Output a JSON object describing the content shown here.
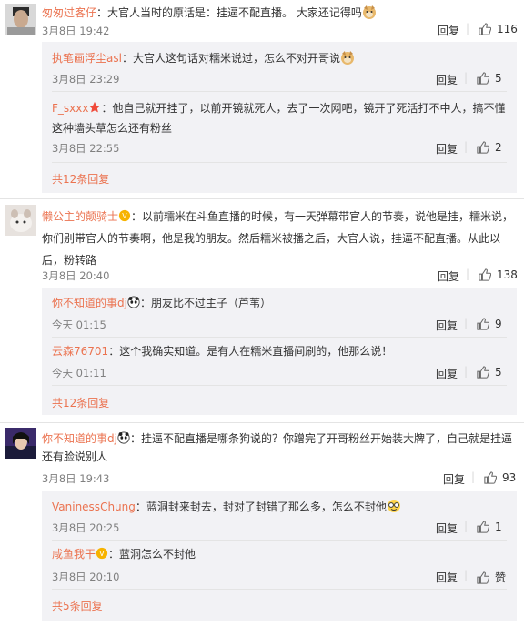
{
  "comments": [
    {
      "user": "匆匆过客仔",
      "text": "：大官人当时的原话是：挂逼不配直播。 大家还记得吗",
      "time": "3月8日 19:42",
      "reply_label": "回复",
      "likes": "116",
      "replies": [
        {
          "user": "执笔画浮尘asl",
          "text": "：大官人这句话对糯米说过，怎么不对开哥说",
          "time": "3月8日 23:29",
          "reply_label": "回复",
          "likes": "5"
        },
        {
          "user": "F_sxxx",
          "text": "：他自己就开挂了，以前开镜就死人，去了一次网吧，镜开了死活打不中人，搞不懂这种墙头草怎么还有粉丝",
          "time": "3月8日 22:55",
          "reply_label": "回复",
          "likes": "2"
        }
      ],
      "more": "共12条回复"
    },
    {
      "user": "懒公主的颠骑士",
      "text": "：以前糯米在斗鱼直播的时候，有一天弹幕带官人的节奏，说他是挂，糯米说，你们别带官人的节奏啊，他是我的朋友。然后糯米被播之后，大官人说，挂逼不配直播。从此以后，粉转路",
      "time": "3月8日 20:40",
      "reply_label": "回复",
      "likes": "138",
      "replies": [
        {
          "user": "你不知道的事dj",
          "text": "：朋友比不过主子（芦苇）",
          "time": "今天 01:15",
          "reply_label": "回复",
          "likes": "9"
        },
        {
          "user": "云森76701",
          "text": "：这个我确实知道。是有人在糯米直播间刷的，他那么说！",
          "time": "今天 01:11",
          "reply_label": "回复",
          "likes": "5"
        }
      ],
      "more": "共12条回复"
    },
    {
      "user": "你不知道的事dj",
      "text": "：挂逼不配直播是哪条狗说的？你蹭完了开哥粉丝开始装大牌了，自己就是挂逼还有脸说别人",
      "time": "3月8日 19:43",
      "reply_label": "回复",
      "likes": "93",
      "replies": [
        {
          "user": "VaninessChung",
          "text": "：蓝洞封来封去，封对了封错了那么多，怎么不封他",
          "time": "3月8日 20:25",
          "reply_label": "回复",
          "likes": "1"
        },
        {
          "user": "咸鱼我干",
          "text": "：蓝洞怎么不封他",
          "time": "3月8日 20:10",
          "reply_label": "回复",
          "likes": "赞"
        }
      ],
      "more": "共5条回复"
    }
  ]
}
